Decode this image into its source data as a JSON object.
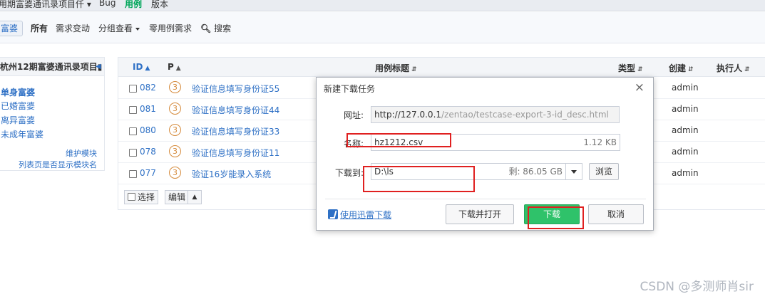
{
  "topnav": {
    "project": "用期富婆通讯录项目仟 ▾",
    "bug": "Bug",
    "testcase": "用例",
    "version": "版本"
  },
  "subbar": {
    "crumb": "富婆",
    "all": "所有",
    "demand_change": "需求变动",
    "group_view": "分组查看",
    "zero_case": "零用例需求",
    "search": "搜索"
  },
  "module": {
    "title": "杭州12期富婆通讯录项目▮",
    "items": [
      "单身富婆",
      "已婚富婆",
      "离异富婆",
      "未成年富婆"
    ],
    "maintain": "维护模块",
    "list_show": "列表页是否显示模块名"
  },
  "table": {
    "headers": {
      "id": "ID",
      "p": "P",
      "title": "用例标题",
      "type": "类型",
      "creator": "创建",
      "executor": "执行人"
    },
    "rows": [
      {
        "id": "082",
        "p": "3",
        "title": "验证信息填写身份证55",
        "creator": "admin"
      },
      {
        "id": "081",
        "p": "3",
        "title": "验证信息填写身份证44",
        "creator": "admin"
      },
      {
        "id": "080",
        "p": "3",
        "title": "验证信息填写身份证33",
        "creator": "admin"
      },
      {
        "id": "078",
        "p": "3",
        "title": "验证信息填写身份证11",
        "creator": "admin"
      },
      {
        "id": "077",
        "p": "3",
        "title": "验证16岁能录入系统",
        "creator": "admin"
      }
    ],
    "select_label": "选择",
    "edit_label": "编辑"
  },
  "dialog": {
    "title": "新建下载任务",
    "close": "×",
    "url_label": "网址:",
    "url_host": "http://127.0.0.1",
    "url_path": "/zentao/testcase-export-3-id_desc.html",
    "name_label": "名称:",
    "file_name": "hz1212.csv",
    "file_size": "1.12 KB",
    "save_label": "下载到:",
    "save_path": "D:\\ls",
    "free_space": "剩: 86.05 GB",
    "browse": "浏览",
    "thunder": "使用迅雷下载",
    "download_open": "下载并打开",
    "download": "下载",
    "cancel": "取消"
  },
  "watermark": "CSDN @多测师肖sir",
  "colors": {
    "link": "#2e70c5",
    "primary": "#2fc26a",
    "highlight": "#e02020"
  }
}
